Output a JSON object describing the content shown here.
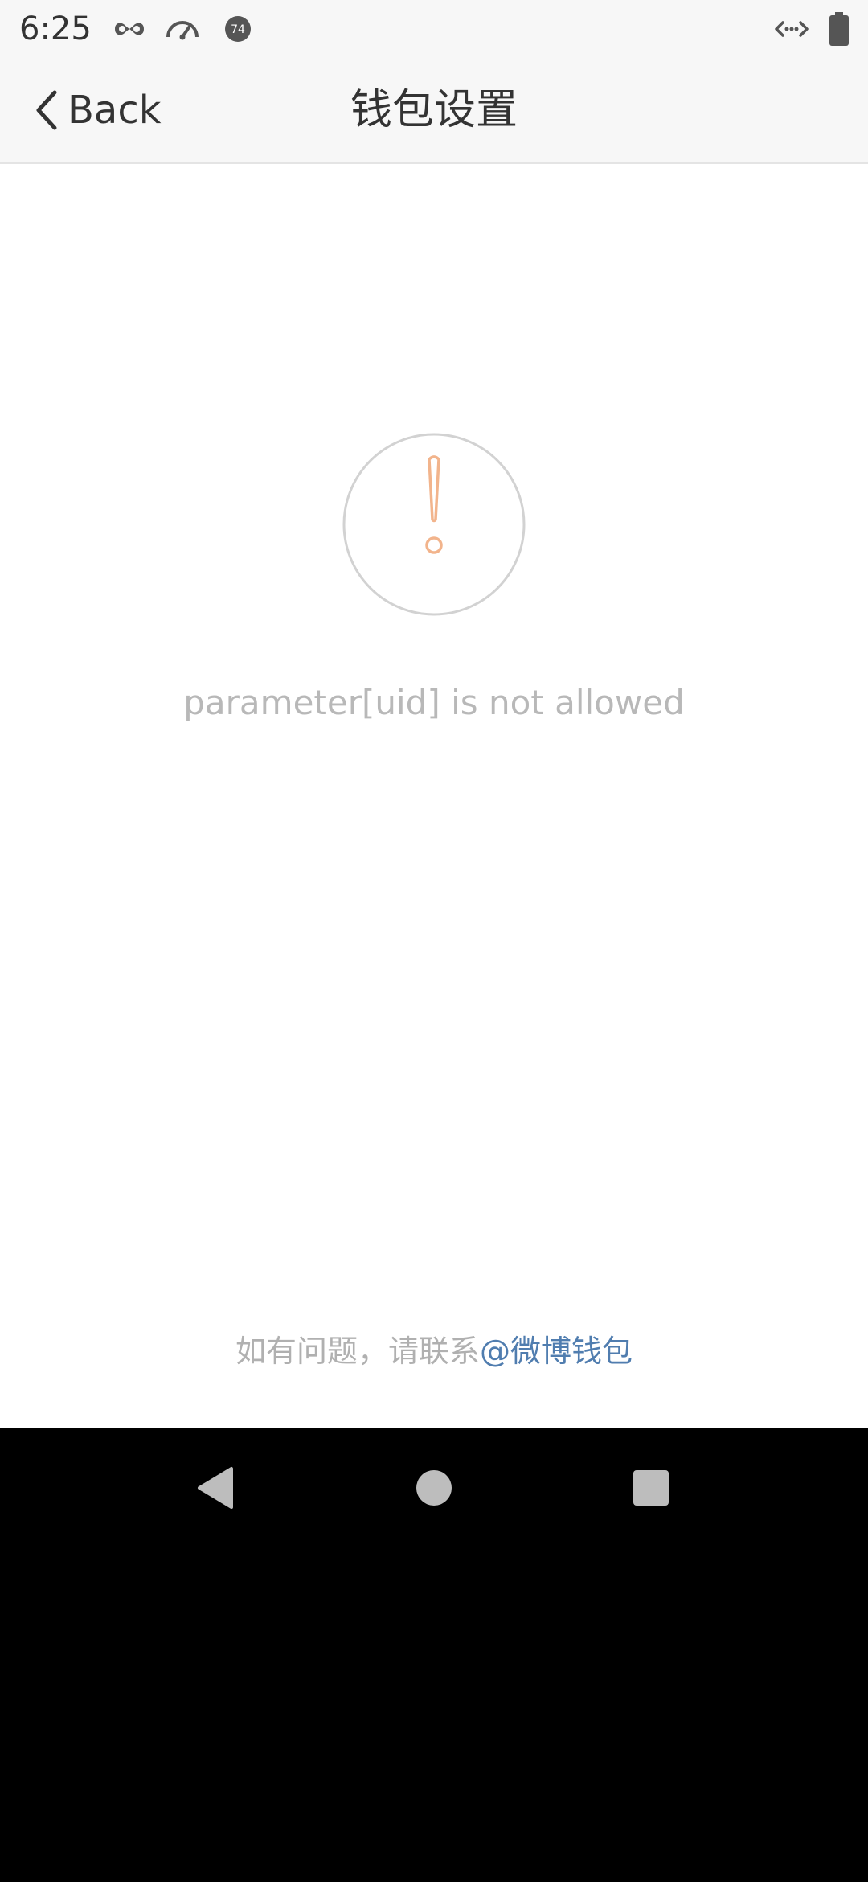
{
  "status_bar": {
    "time": "6:25",
    "icons": [
      "incognito-icon",
      "speedometer-icon",
      "notification-count-icon",
      "data-transfer-icon",
      "battery-icon"
    ],
    "notification_count": "74"
  },
  "header": {
    "back_label": "Back",
    "title": "钱包设置"
  },
  "main": {
    "icon": "warning-exclamation-icon",
    "error_message": "parameter[uid] is not allowed",
    "footer_prefix": "如有问题，请联系",
    "footer_link": "@微博钱包"
  },
  "nav": {
    "icons": [
      "back-triangle-icon",
      "home-circle-icon",
      "recents-square-icon"
    ]
  },
  "colors": {
    "accent_orange": "#f2b48c",
    "link_blue": "#507daf",
    "muted_text": "#b8b8b8"
  }
}
